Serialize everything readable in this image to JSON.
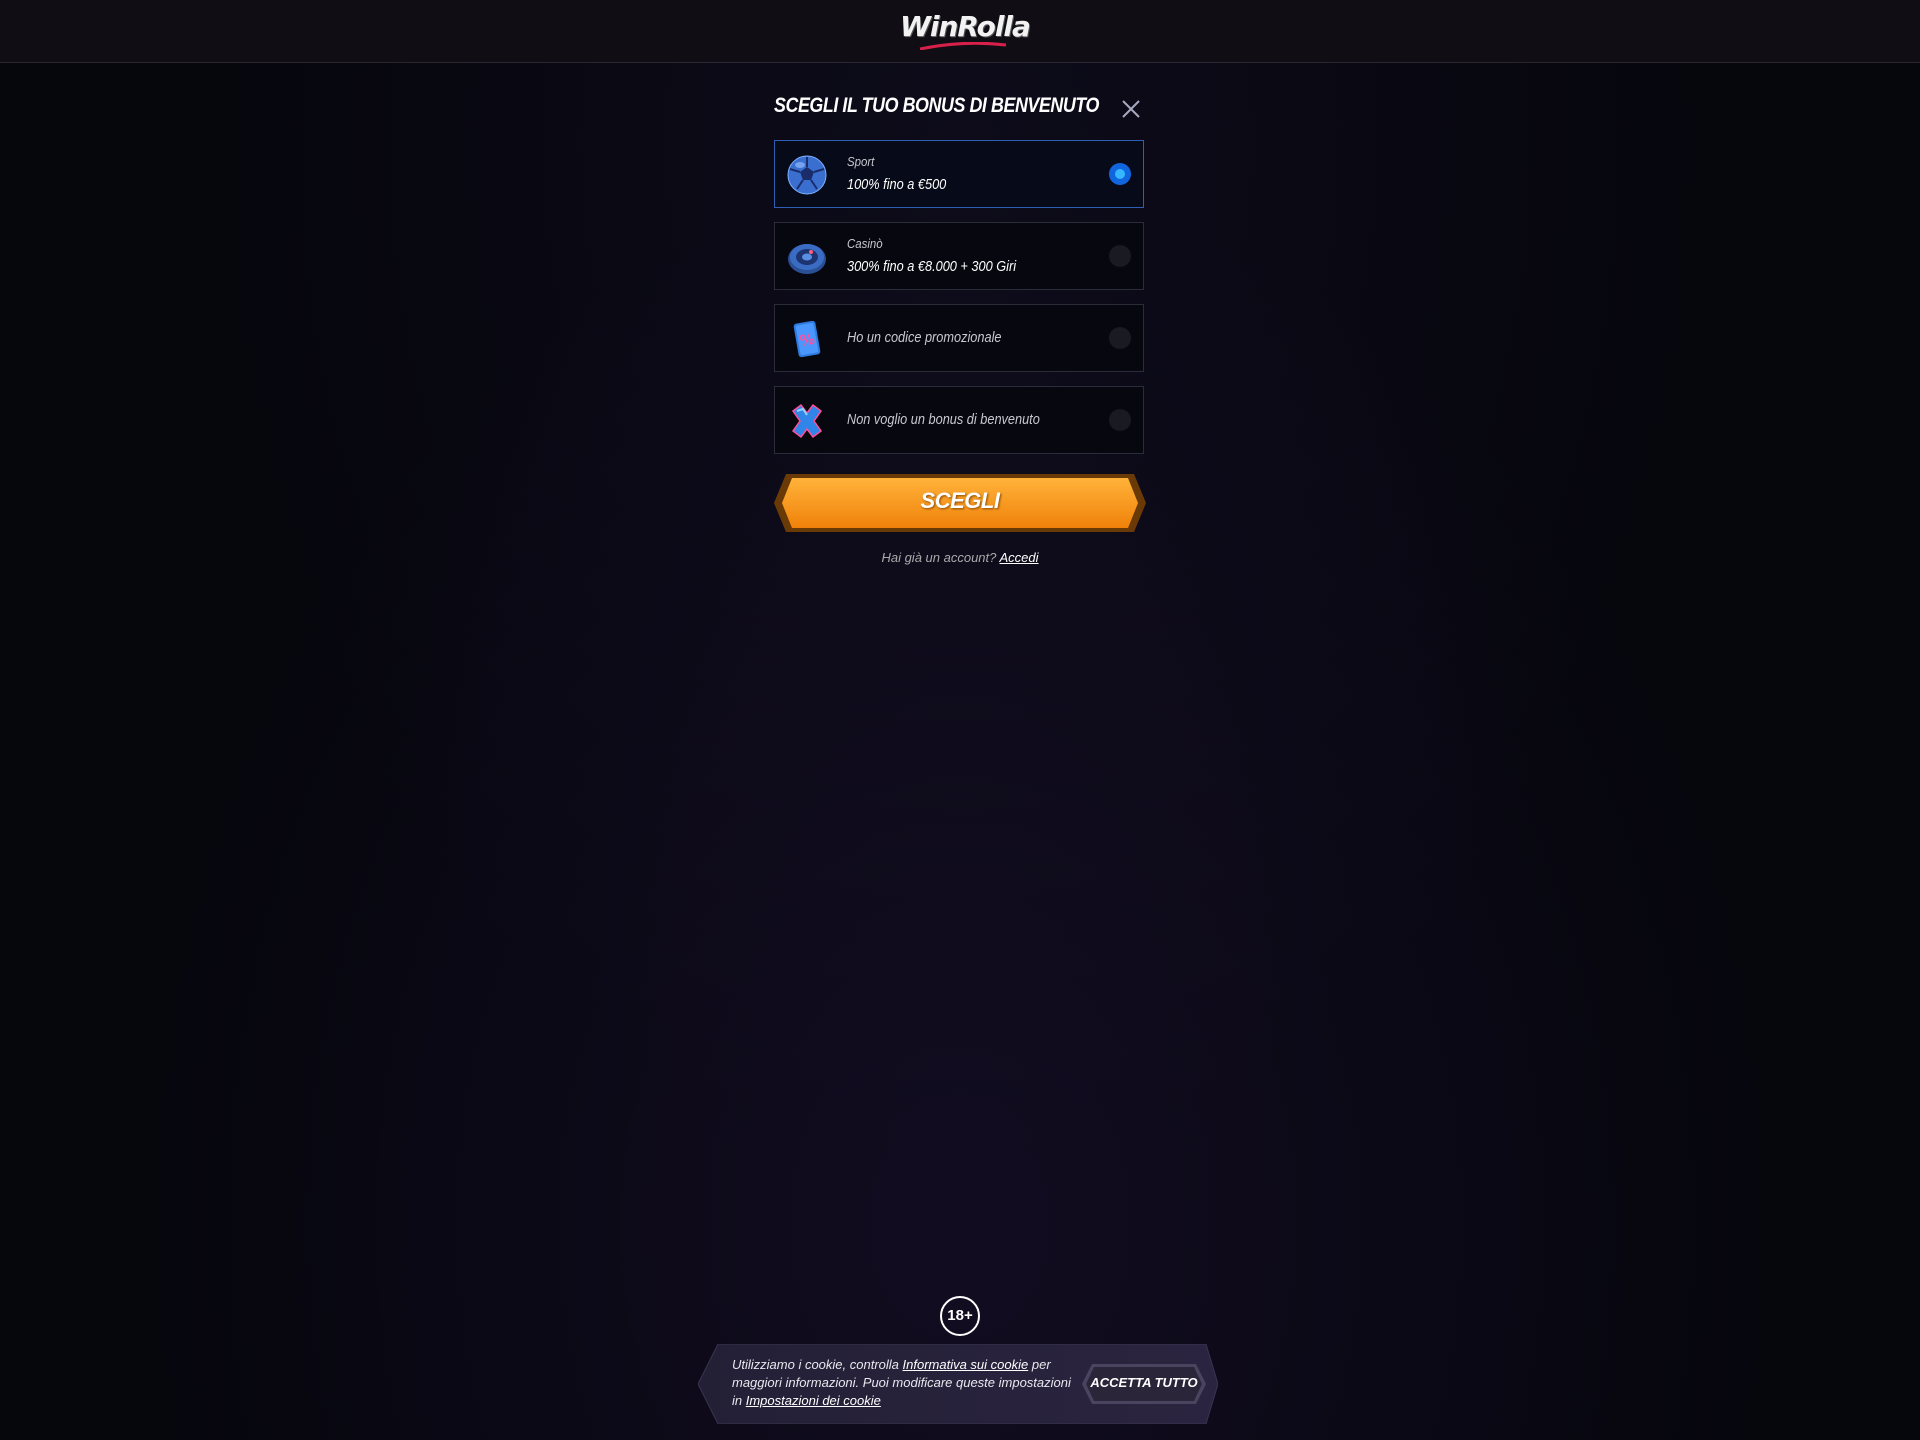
{
  "header": {
    "logo_text": "WinRolla"
  },
  "modal": {
    "title": "SCEGLI IL TUO BONUS DI BENVENUTO",
    "close_icon": "close-icon",
    "options": [
      {
        "label": "Sport",
        "value": "100% fino a €500",
        "icon": "soccer-ball-icon",
        "selected": true
      },
      {
        "label": "Casinò",
        "value": "300% fino a €8.000 + 300 Giri",
        "icon": "roulette-wheel-icon",
        "selected": false
      },
      {
        "label": "Ho un codice promozionale",
        "icon": "promo-code-card-icon",
        "selected": false
      },
      {
        "label": "Non voglio un bonus di benvenuto",
        "icon": "no-bonus-x-icon",
        "selected": false
      }
    ],
    "submit_label": "SCEGLI",
    "account_prompt": "Hai già un account?",
    "login_link": "Accedi"
  },
  "age_badge": "18+",
  "cookie_banner": {
    "text_before": "Utilizziamo i cookie, controlla ",
    "policy_link": "Informativa sui cookie",
    "text_after": " per maggiori informazioni. Puoi modificare queste impostazioni in ",
    "settings_link": "Impostazioni dei cookie",
    "accept_label": "ACCETTA TUTTO"
  },
  "colors": {
    "accent_orange": "#f59a18",
    "selected_blue": "#1166e0",
    "background": "#06060d"
  }
}
